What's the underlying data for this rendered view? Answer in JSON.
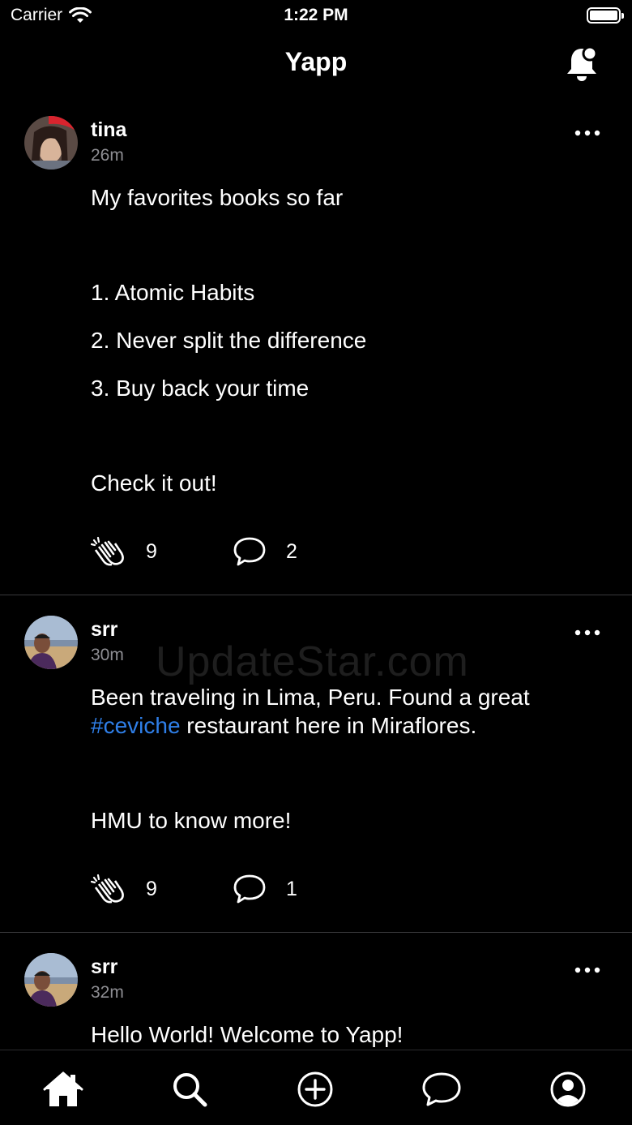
{
  "status_bar": {
    "carrier": "Carrier",
    "time": "1:22 PM"
  },
  "nav": {
    "title": "Yapp"
  },
  "posts": [
    {
      "username": "tina",
      "time": "26m",
      "lines": [
        "My favorites books so far",
        "1. Atomic Habits",
        "2. Never split the difference",
        "3. Buy back your time",
        "Check it out!"
      ],
      "claps": "9",
      "comments": "2"
    },
    {
      "username": "srr",
      "time": "30m",
      "line1": "Been traveling in Lima, Peru. Found a great",
      "hashtag": "#ceviche",
      "line2_rest": " restaurant here in Miraflores.",
      "line3": "HMU to know more!",
      "claps": "9",
      "comments": "1"
    },
    {
      "username": "srr",
      "time": "32m",
      "line1": "Hello World! Welcome to Yapp!"
    }
  ],
  "watermark": "UpdateStar.com",
  "tabs": [
    {
      "icon": "home-icon"
    },
    {
      "icon": "search-icon"
    },
    {
      "icon": "add-circle-icon"
    },
    {
      "icon": "chat-bubble-icon"
    },
    {
      "icon": "profile-icon"
    }
  ],
  "colors": {
    "background": "#000000",
    "hashtag": "#2f7fe8",
    "secondary_text": "#8e8e93",
    "divider": "#3a3a3c"
  }
}
